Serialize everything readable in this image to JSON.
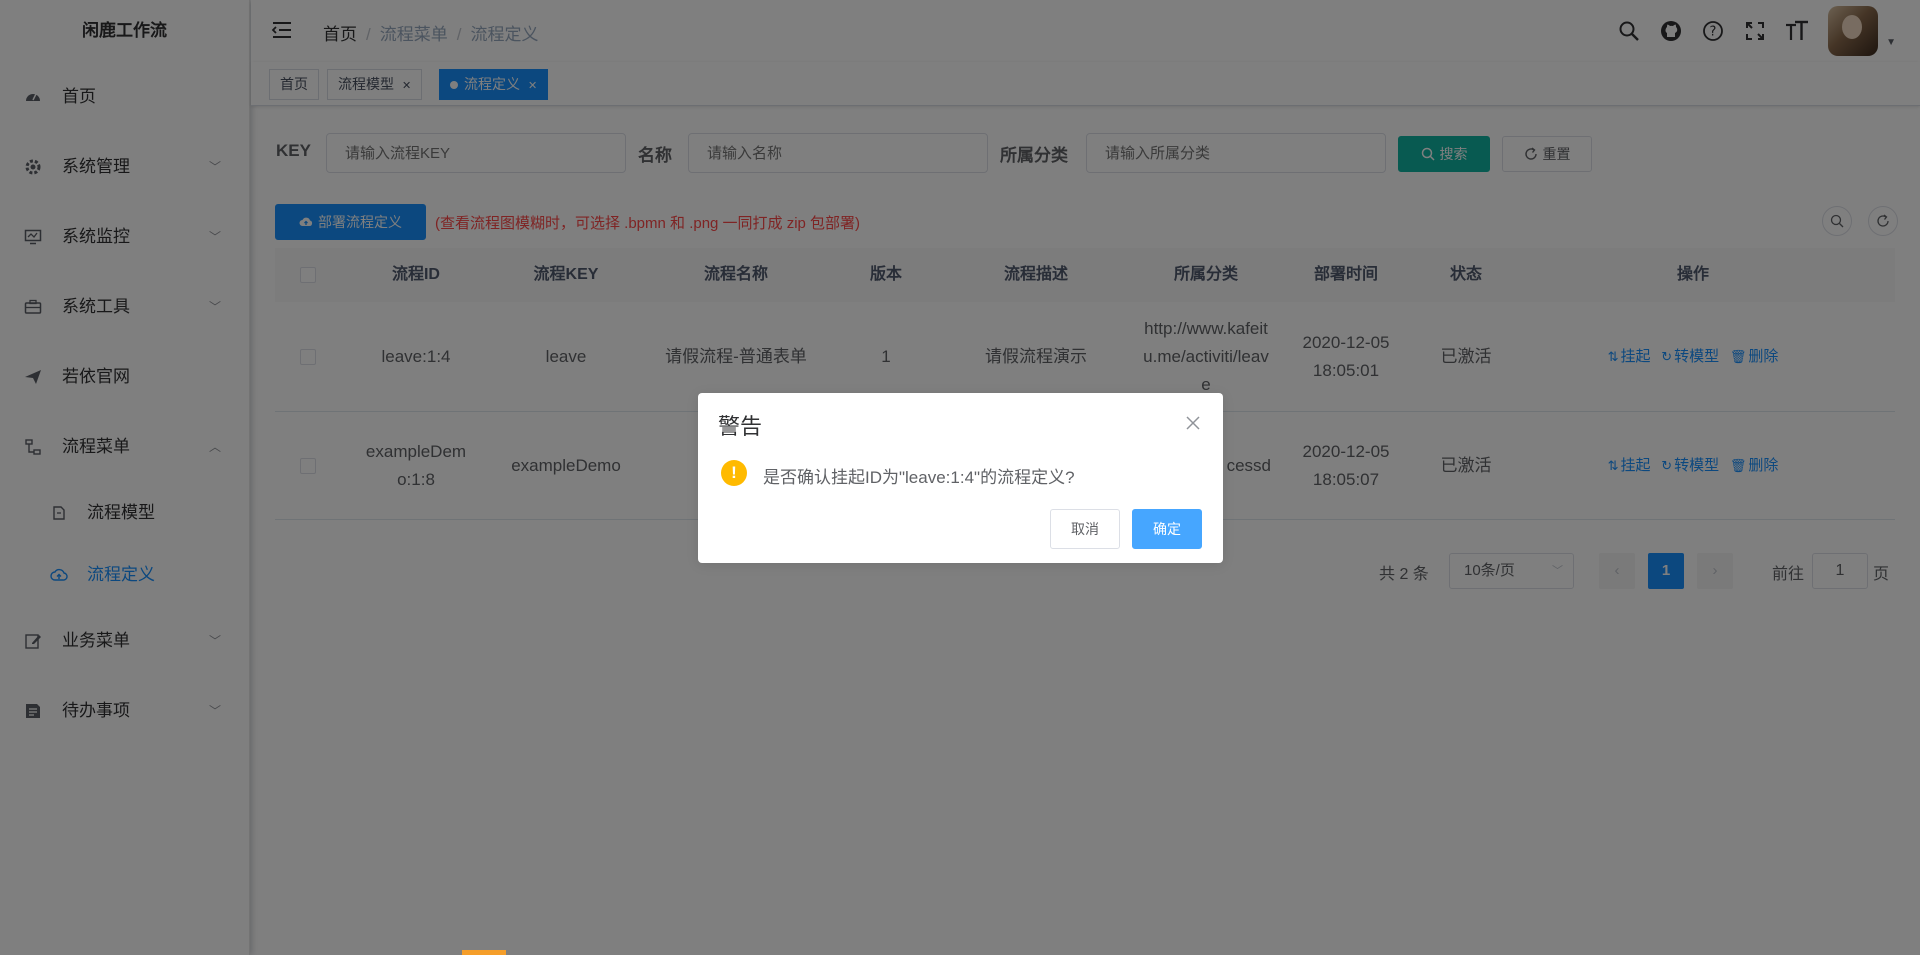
{
  "app": {
    "title": "闲鹿工作流"
  },
  "sidebar": {
    "items": [
      {
        "label": "首页",
        "icon": "dashboard-icon"
      },
      {
        "label": "系统管理",
        "icon": "gear-icon"
      },
      {
        "label": "系统监控",
        "icon": "monitor-icon"
      },
      {
        "label": "系统工具",
        "icon": "toolbox-icon"
      },
      {
        "label": "若依官网",
        "icon": "paper-plane-icon"
      },
      {
        "label": "流程菜单",
        "icon": "flow-icon"
      },
      {
        "label": "业务菜单",
        "icon": "edit-icon"
      },
      {
        "label": "待办事项",
        "icon": "list-icon"
      }
    ],
    "sub_items": [
      {
        "label": "流程模型",
        "icon": "model-icon"
      },
      {
        "label": "流程定义",
        "icon": "cloud-upload-icon",
        "active": true
      }
    ]
  },
  "navbar": {
    "breadcrumb": [
      "首页",
      "流程菜单",
      "流程定义"
    ]
  },
  "tags": [
    {
      "label": "首页"
    },
    {
      "label": "流程模型"
    },
    {
      "label": "流程定义",
      "active": true
    }
  ],
  "search": {
    "key_label": "KEY",
    "key_placeholder": "请输入流程KEY",
    "name_label": "名称",
    "name_placeholder": "请输入名称",
    "category_label": "所属分类",
    "category_placeholder": "请输入所属分类",
    "search_btn": "搜索",
    "reset_btn": "重置"
  },
  "toolbar": {
    "deploy_btn": "部署流程定义",
    "hint": "(查看流程图模糊时，可选择 .bpmn 和 .png 一同打成 zip 包部署)"
  },
  "table": {
    "headers": [
      "流程ID",
      "流程KEY",
      "流程名称",
      "版本",
      "流程描述",
      "所属分类",
      "部署时间",
      "状态",
      "操作"
    ],
    "rows": [
      {
        "id": "leave:1:4",
        "key": "leave",
        "name": "请假流程-普通表单",
        "version": "1",
        "desc": "请假流程演示",
        "category": "http://www.kafeitu.me/activiti/leave",
        "deploy_date": "2020-12-05",
        "deploy_time": "18:05:01",
        "status": "已激活"
      },
      {
        "id": "exampleDemo:1:8",
        "key": "exampleDemo",
        "name": "",
        "version": "",
        "desc": "",
        "category": "w.activ cessd",
        "deploy_date": "2020-12-05",
        "deploy_time": "18:05:07",
        "status": "已激活"
      }
    ],
    "actions": {
      "suspend": "挂起",
      "to_model": "转模型",
      "delete": "删除"
    }
  },
  "pagination": {
    "total": "共 2 条",
    "page_size": "10条/页",
    "current": "1",
    "goto": "前往",
    "goto_value": "1",
    "page_unit": "页"
  },
  "dialog": {
    "title": "警告",
    "message": "是否确认挂起ID为\"leave:1:4\"的流程定义?",
    "cancel": "取消",
    "confirm": "确定"
  },
  "colors": {
    "primary": "#1890ff",
    "search_button": "#11b5a3",
    "warning": "#ffba00",
    "danger_text": "#ff4949"
  }
}
